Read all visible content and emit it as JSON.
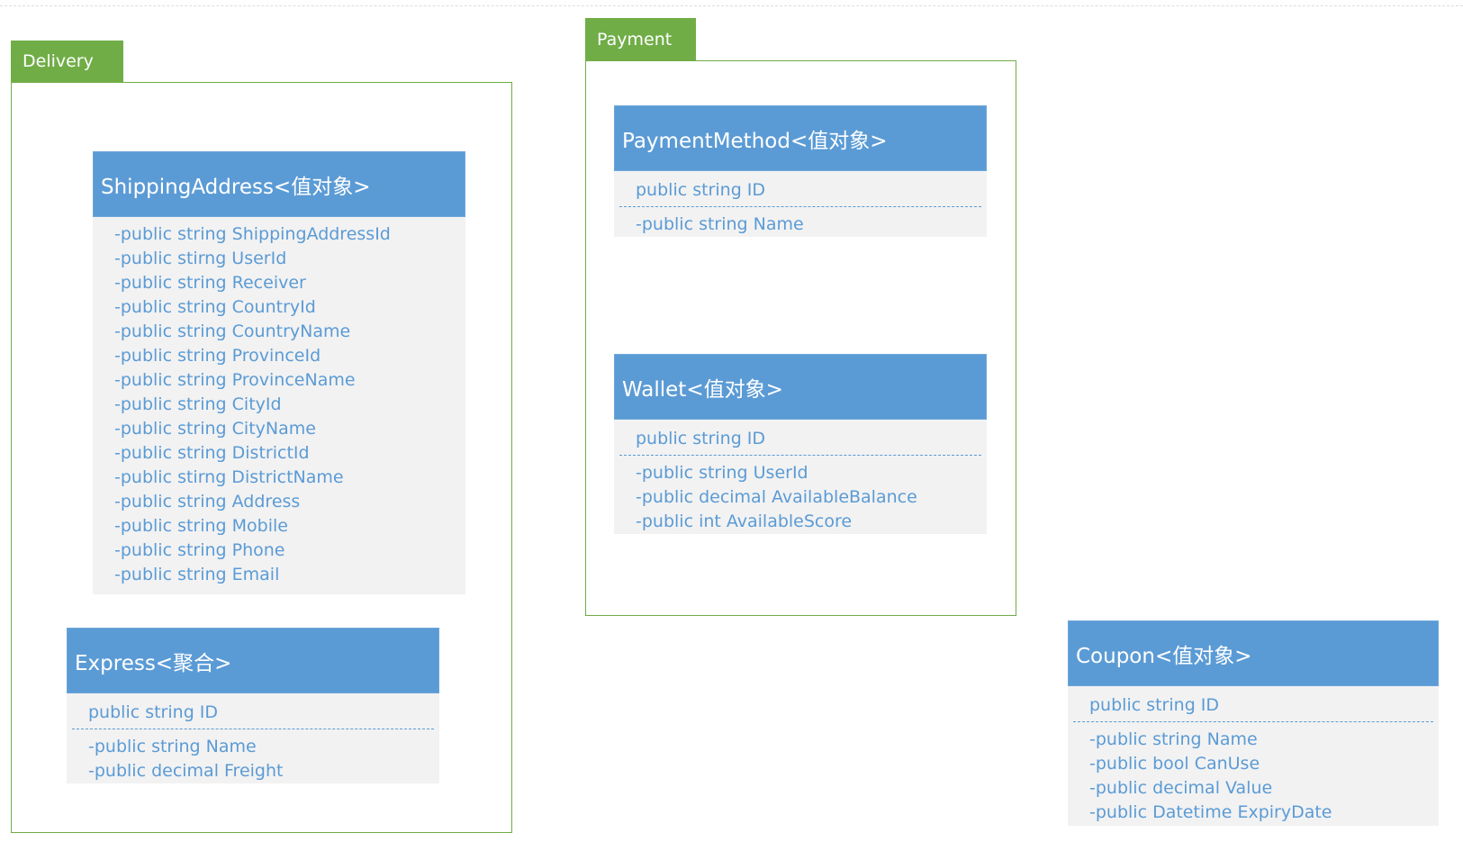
{
  "colors": {
    "group": "#70ad47",
    "header": "#5b9bd5",
    "body": "#f2f2f2",
    "text": "#5b9bd5"
  },
  "groups": {
    "delivery": "Delivery",
    "payment": "Payment"
  },
  "shipping": {
    "title": "ShippingAddress<值对象>",
    "attrs": [
      "-public string ShippingAddressId",
      "-public stirng UserId",
      "-public string Receiver",
      "-public string CountryId",
      "-public string CountryName",
      "-public string ProvinceId",
      "-public string ProvinceName",
      "-public string CityId",
      "-public string CityName",
      "-public string DistrictId",
      "-public stirng DistrictName",
      "-public string Address",
      "-public string Mobile",
      "-public string Phone",
      "-public string Email"
    ]
  },
  "express": {
    "title": "Express<聚合>",
    "id": "public string ID",
    "attrs": [
      "-public string Name",
      "-public decimal Freight"
    ]
  },
  "paymentMethod": {
    "title": "PaymentMethod<值对象>",
    "id": "public string ID",
    "attrs": [
      "-public string Name"
    ]
  },
  "wallet": {
    "title": "Wallet<值对象>",
    "id": "public string ID",
    "attrs": [
      "-public string UserId",
      "-public decimal AvailableBalance",
      "-public int AvailableScore"
    ]
  },
  "coupon": {
    "title": "Coupon<值对象>",
    "id": "public string ID",
    "attrs": [
      "-public string Name",
      "-public bool CanUse",
      "-public decimal Value",
      "-public Datetime ExpiryDate"
    ]
  }
}
